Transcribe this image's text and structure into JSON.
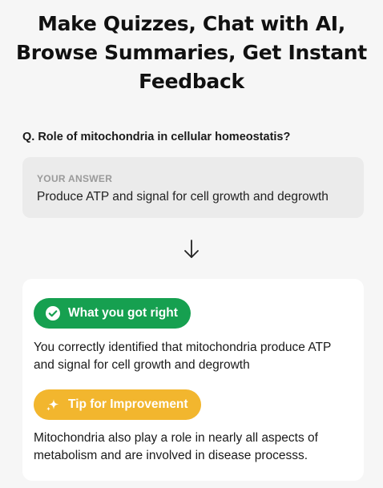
{
  "headline": {
    "line1": "Make Quizzes, Chat with AI,",
    "line2": "Browse Summaries, Get Instant",
    "line3": "Feedback"
  },
  "question": {
    "text": "Q. Role of mitochondria in cellular homeostatis?"
  },
  "answer": {
    "label": "YOUR ANSWER",
    "text": "Produce ATP and signal for cell growth and degrowth"
  },
  "arrow": {
    "icon": "arrow-down-icon"
  },
  "feedback": {
    "correct": {
      "label": "What you got right",
      "icon": "check-circle-icon",
      "color": "#16a050",
      "text": "You correctly identified that mitochondria produce ATP and signal for cell growth and degrowth"
    },
    "tip": {
      "label": "Tip for Improvement",
      "icon": "sparkle-icon",
      "color": "#f2b62e",
      "text": "Mitochondria also play a role in nearly all aspects of metabolism and are involved in disease processs."
    }
  }
}
